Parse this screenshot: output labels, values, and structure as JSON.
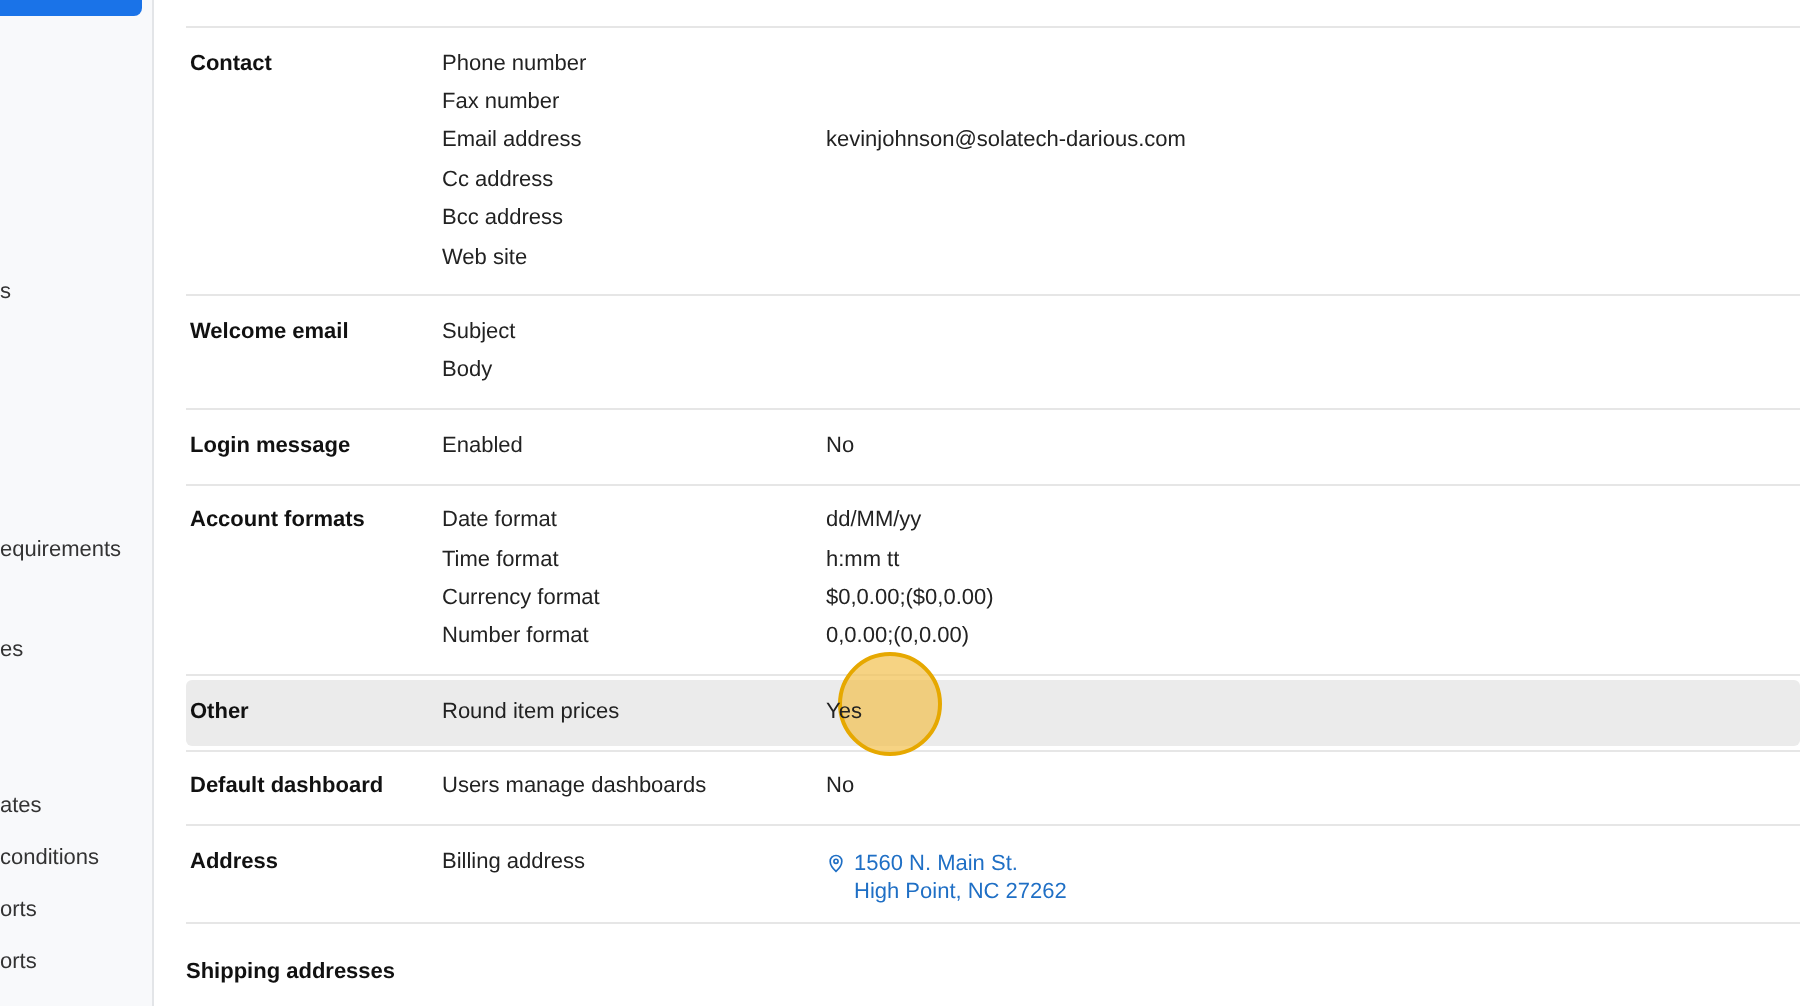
{
  "sidebar": {
    "items": [
      {
        "selected": true
      },
      {
        "label": "s",
        "selected": false
      },
      {
        "label": "equirements",
        "selected": false
      },
      {
        "label": "es",
        "selected": false
      },
      {
        "label": "ates",
        "selected": false
      },
      {
        "label": "conditions",
        "selected": false
      },
      {
        "label": "orts",
        "selected": false
      },
      {
        "label": "orts",
        "selected": false
      }
    ]
  },
  "sections": [
    {
      "title": "Contact",
      "highlighted": false,
      "rows": [
        {
          "label": "Phone number",
          "value": ""
        },
        {
          "label": "Fax number",
          "value": ""
        },
        {
          "label": "Email address",
          "value": "kevinjohnson@solatech-darious.com"
        },
        {
          "label": "Cc address",
          "value": ""
        },
        {
          "label": "Bcc address",
          "value": ""
        },
        {
          "label": "Web site",
          "value": ""
        }
      ]
    },
    {
      "title": "Welcome email",
      "highlighted": false,
      "rows": [
        {
          "label": "Subject",
          "value": ""
        },
        {
          "label": "Body",
          "value": ""
        }
      ]
    },
    {
      "title": "Login message",
      "highlighted": false,
      "rows": [
        {
          "label": "Enabled",
          "value": "No"
        }
      ]
    },
    {
      "title": "Account formats",
      "highlighted": false,
      "rows": [
        {
          "label": "Date format",
          "value": "dd/MM/yy"
        },
        {
          "label": "Time format",
          "value": "h:mm tt"
        },
        {
          "label": "Currency format",
          "value": "$0,0.00;($0,0.00)"
        },
        {
          "label": "Number format",
          "value": "0,0.00;(0,0.00)"
        }
      ]
    },
    {
      "title": "Other",
      "highlighted": true,
      "click_indicator": true,
      "rows": [
        {
          "label": "Round item prices",
          "value": "Yes"
        }
      ]
    },
    {
      "title": "Default dashboard",
      "highlighted": false,
      "rows": [
        {
          "label": "Users manage dashboards",
          "value": "No"
        }
      ]
    },
    {
      "title": "Address",
      "highlighted": false,
      "rows": [
        {
          "label": "Billing address",
          "kind": "address",
          "lines": [
            "1560 N. Main St.",
            "High Point, NC 27262"
          ]
        }
      ]
    }
  ],
  "footer_heading": "Shipping addresses"
}
